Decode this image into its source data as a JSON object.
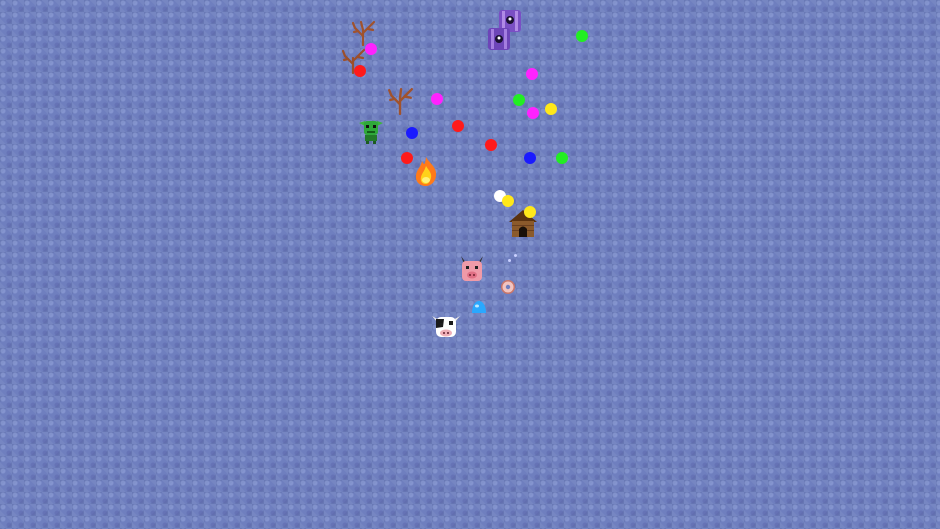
{
  "colors": {
    "background": "#6f7fbf",
    "orb_red": "#ff1a1a",
    "orb_blue": "#1a1aff",
    "orb_green": "#22ee22",
    "orb_magenta": "#ff22ff",
    "orb_yellow": "#ffe81a",
    "orb_white": "#ffffff"
  },
  "sprites": [
    "purple-creature-icon",
    "purple-creature-icon",
    "dead-tree-icon",
    "dead-tree-icon",
    "dead-tree-icon",
    "green-goblin-icon",
    "campfire-icon",
    "wooden-hut-icon",
    "pig-face-icon",
    "donut-icon",
    "blue-slime-icon",
    "cow-face-icon"
  ],
  "orbs": [
    {
      "color": "magenta"
    },
    {
      "color": "red"
    },
    {
      "color": "green"
    },
    {
      "color": "magenta"
    },
    {
      "color": "magenta"
    },
    {
      "color": "green"
    },
    {
      "color": "magenta"
    },
    {
      "color": "yellow"
    },
    {
      "color": "blue"
    },
    {
      "color": "red"
    },
    {
      "color": "red"
    },
    {
      "color": "red"
    },
    {
      "color": "blue"
    },
    {
      "color": "green"
    },
    {
      "color": "white"
    },
    {
      "color": "yellow"
    },
    {
      "color": "yellow"
    }
  ]
}
